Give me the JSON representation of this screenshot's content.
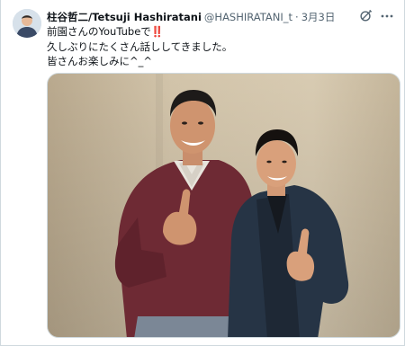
{
  "tweet": {
    "author": {
      "display_name": "柱谷哲二/Tetsuji Hashiratani",
      "handle": "@HASHIRATANI_t",
      "separator": "·",
      "date": "3月3日"
    },
    "text_lines": [
      "前園さんのYouTubeで",
      "久しぶりにたくさん話ししてきました。",
      "皆さんお楽しみに^_^"
    ],
    "emoji": "‼️",
    "icons": {
      "avatar": "avatar-photo",
      "grok": "grok-icon",
      "more": "more-icon"
    },
    "colors": {
      "text": "#0f1419",
      "secondary": "#536471",
      "border": "#cfd9de",
      "emoji_red": "#d81f26"
    },
    "media": {
      "type": "photo",
      "content": "two-men-thumbs-up"
    }
  }
}
